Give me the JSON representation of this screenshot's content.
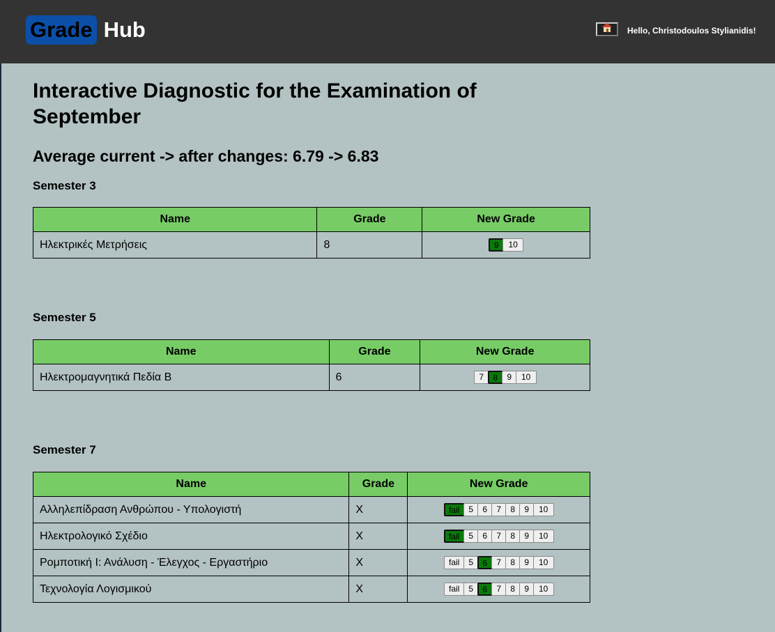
{
  "header": {
    "logo_part1": "Grade",
    "logo_part2": "Hub",
    "home_icon": "house-icon",
    "greeting": "Hello, Christodoulos Stylianidis!"
  },
  "page": {
    "title": "Interactive Diagnostic for the Examination of September",
    "average": "Average current -> after changes: 6.79 -> 6.83"
  },
  "columns": {
    "name": "Name",
    "grade": "Grade",
    "new_grade": "New Grade"
  },
  "colors": {
    "header_bar": "#333333",
    "logo_bg": "#0b4fa8",
    "page_bg": "#b3c2c3",
    "table_head": "#77cc66",
    "selected_grade": "#0a7a0a"
  },
  "semesters": [
    {
      "title": "Semester 3",
      "courses": [
        {
          "name": "Ηλεκτρικές Μετρήσεις",
          "grade": "8",
          "options": [
            "9",
            "10"
          ],
          "selected": "9"
        }
      ]
    },
    {
      "title": "Semester 5",
      "courses": [
        {
          "name": "Ηλεκτρομαγνητικά Πεδία Β",
          "grade": "6",
          "options": [
            "7",
            "8",
            "9",
            "10"
          ],
          "selected": "8"
        }
      ]
    },
    {
      "title": "Semester 7",
      "courses": [
        {
          "name": "Αλληλεπίδραση Ανθρώπου - Υπολογιστή",
          "grade": "X",
          "options": [
            "fail",
            "5",
            "6",
            "7",
            "8",
            "9",
            "10"
          ],
          "selected": "fail"
        },
        {
          "name": "Ηλεκτρολογικό Σχέδιο",
          "grade": "X",
          "options": [
            "fail",
            "5",
            "6",
            "7",
            "8",
            "9",
            "10"
          ],
          "selected": "fail"
        },
        {
          "name": "Ρομποτική Ι: Ανάλυση - Έλεγχος - Εργαστήριο",
          "grade": "X",
          "options": [
            "fail",
            "5",
            "6",
            "7",
            "8",
            "9",
            "10"
          ],
          "selected": "6"
        },
        {
          "name": "Τεχνολογία Λογισμικού",
          "grade": "X",
          "options": [
            "fail",
            "5",
            "6",
            "7",
            "8",
            "9",
            "10"
          ],
          "selected": "6"
        }
      ]
    }
  ]
}
